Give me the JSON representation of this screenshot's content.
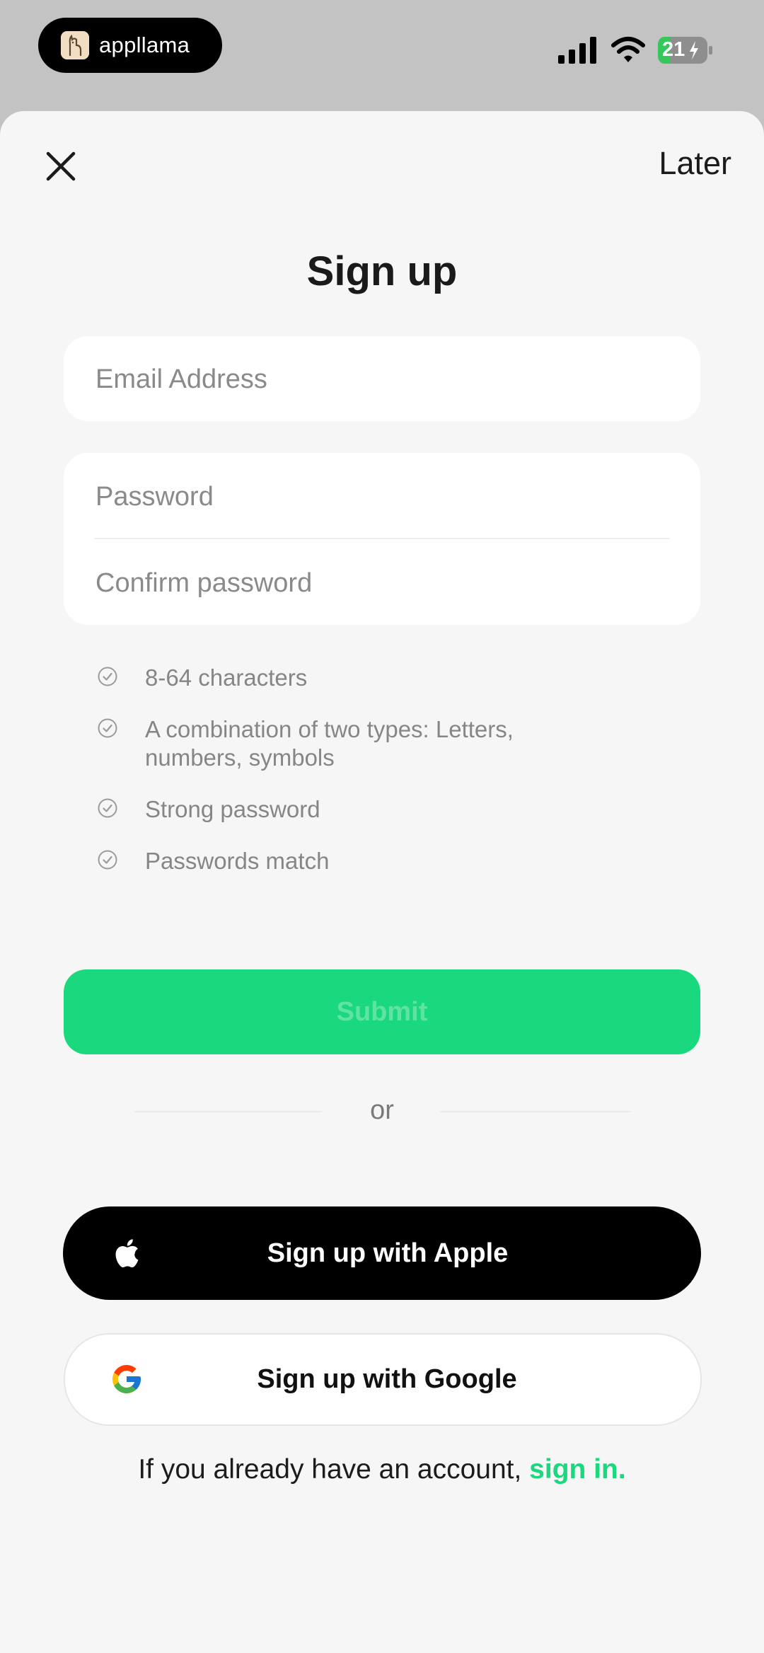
{
  "status_bar": {
    "app_name": "appllama",
    "battery_level": "21",
    "battery_color": "#34c759"
  },
  "header": {
    "close_icon": "close-icon",
    "later_label": "Later"
  },
  "title": "Sign up",
  "form": {
    "email_placeholder": "Email Address",
    "email_value": "",
    "password_placeholder": "Password",
    "password_value": "",
    "confirm_placeholder": "Confirm password",
    "confirm_value": ""
  },
  "requirements": [
    {
      "text": "8-64 characters",
      "icon": "check-circle-icon"
    },
    {
      "text": "A combination of two types: Letters, numbers, symbols",
      "icon": "check-circle-icon"
    },
    {
      "text": "Strong password",
      "icon": "check-circle-icon"
    },
    {
      "text": "Passwords match",
      "icon": "check-circle-icon"
    }
  ],
  "submit_label": "Submit",
  "divider_label": "or",
  "social": {
    "apple_label": "Sign up with Apple",
    "google_label": "Sign up with Google"
  },
  "footer": {
    "prefix": "If you already have an account, ",
    "link": "sign in."
  },
  "colors": {
    "accent": "#1ad87d",
    "background": "#f6f6f6",
    "overlay": "#c3c3c3"
  }
}
